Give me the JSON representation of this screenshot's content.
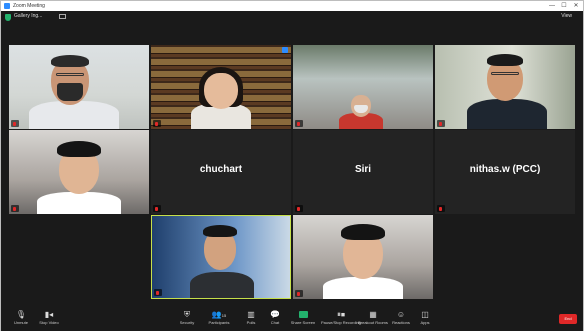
{
  "window": {
    "title": "Zoom Meeting",
    "min_glyph": "—",
    "max_glyph": "☐",
    "close_glyph": "✕"
  },
  "meeting_bar": {
    "label": "Gallery Ing...",
    "view_label": "View"
  },
  "tiles": [
    {
      "name": "",
      "video": true
    },
    {
      "name": "",
      "video": true
    },
    {
      "name": "",
      "video": true
    },
    {
      "name": "",
      "video": true
    },
    {
      "name": "",
      "video": true
    },
    {
      "name": "",
      "big_name": "chuchart",
      "video": false
    },
    {
      "name": "",
      "big_name": "Siri",
      "video": false
    },
    {
      "name": "",
      "big_name": "nithas.w (PCC)",
      "video": false
    },
    {
      "name": "",
      "video": true
    },
    {
      "name": "",
      "video": true
    }
  ],
  "toolbar": {
    "unmute": "Unmute",
    "stop_video": "Stop Video",
    "security": "Security",
    "participants": "Participants",
    "participants_count": "15",
    "polls": "Polls",
    "chat": "Chat",
    "share_screen": "Share Screen",
    "pause_share": "Pause/Stop Recording",
    "breakout": "Breakout Rooms",
    "reactions": "Reactions",
    "apps": "Apps",
    "end": "End"
  },
  "colors": {
    "background": "#1a1a1a",
    "tile": "#232323",
    "active_speaker": "#c6e04a",
    "end": "#e02828",
    "share": "#23b26d",
    "accent": "#2d8cff"
  }
}
